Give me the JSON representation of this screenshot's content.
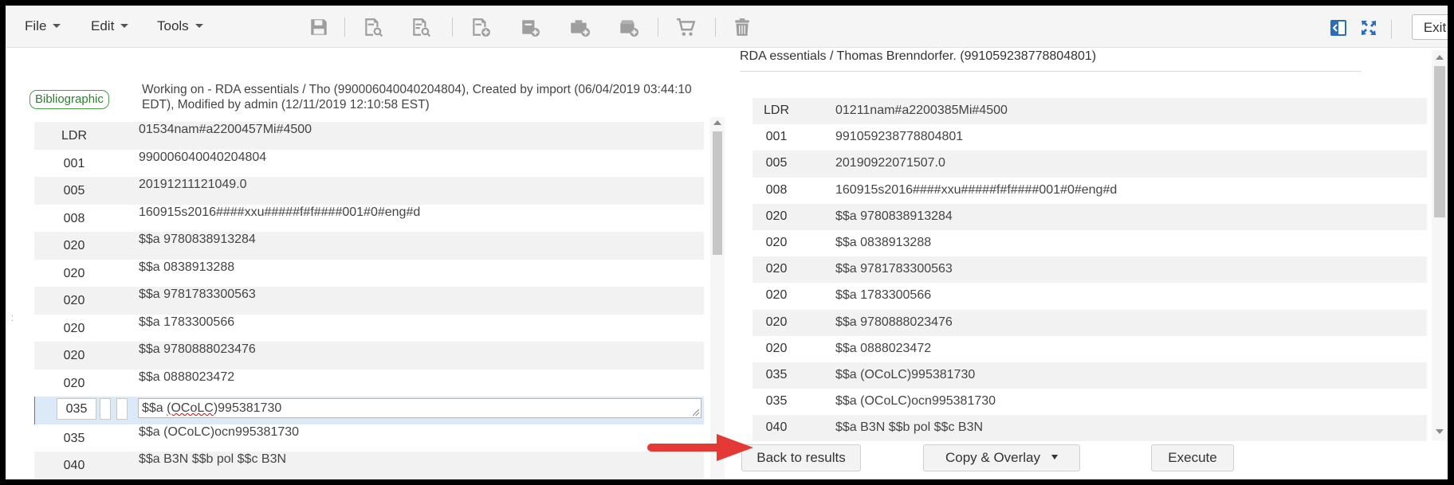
{
  "toolbar": {
    "menus": [
      "File",
      "Edit",
      "Tools"
    ],
    "exit_label": "Exit"
  },
  "left": {
    "badge": "Bibliographic",
    "working_on": "Working on - RDA essentials / Tho (990006040040204804), Created by import (06/04/2019 03:44:10 EDT), Modified by admin (12/11/2019 12:10:58 EST)",
    "rows": [
      {
        "tag": "LDR",
        "value": "01534nam#a2200457Mi#4500"
      },
      {
        "tag": "001",
        "value": "990006040040204804"
      },
      {
        "tag": "005",
        "value": "20191211121049.0"
      },
      {
        "tag": "008",
        "value": "160915s2016####xxu#####f#f####001#0#eng#d"
      },
      {
        "tag": "020",
        "value": "$$a 9780838913284"
      },
      {
        "tag": "020",
        "value": "$$a 0838913288"
      },
      {
        "tag": "020",
        "value": "$$a 9781783300563"
      },
      {
        "tag": "020",
        "value": "$$a 1783300566"
      },
      {
        "tag": "020",
        "value": "$$a 9780888023476"
      },
      {
        "tag": "020",
        "value": "$$a 0888023472"
      }
    ],
    "selected_row": {
      "tag": "035",
      "prefix": "$$a ",
      "squiggle": "(OCoLC",
      "suffix": ")995381730"
    },
    "rows_after": [
      {
        "tag": "035",
        "value": "$$a (OCoLC)ocn995381730"
      },
      {
        "tag": "040",
        "value": "$$a B3N $$b pol $$c B3N"
      }
    ]
  },
  "right": {
    "title": "RDA essentials / Thomas Brenndorfer. (991059238778804801)",
    "rows": [
      {
        "tag": "LDR",
        "value": "01211nam#a2200385Mi#4500"
      },
      {
        "tag": "001",
        "value": "991059238778804801"
      },
      {
        "tag": "005",
        "value": "20190922071507.0"
      },
      {
        "tag": "008",
        "value": "160915s2016####xxu#####f#f####001#0#eng#d"
      },
      {
        "tag": "020",
        "value": "$$a 9780838913284"
      },
      {
        "tag": "020",
        "value": "$$a 0838913288"
      },
      {
        "tag": "020",
        "value": "$$a 9781783300563"
      },
      {
        "tag": "020",
        "value": "$$a 1783300566"
      },
      {
        "tag": "020",
        "value": "$$a 9780888023476"
      },
      {
        "tag": "020",
        "value": "$$a 0888023472"
      },
      {
        "tag": "035",
        "value": "$$a (OCoLC)995381730"
      },
      {
        "tag": "035",
        "value": "$$a (OCoLC)ocn995381730"
      },
      {
        "tag": "040",
        "value": "$$a B3N $$b pol $$c B3N"
      }
    ]
  },
  "buttons": {
    "back": "Back to results",
    "copy_overlay": "Copy & Overlay",
    "execute": "Execute"
  },
  "colors": {
    "selected_row": "#dce9f6",
    "badge_green": "#2e7d32",
    "arrow_red": "#e53935",
    "icon_blue": "#2a6ebb"
  }
}
